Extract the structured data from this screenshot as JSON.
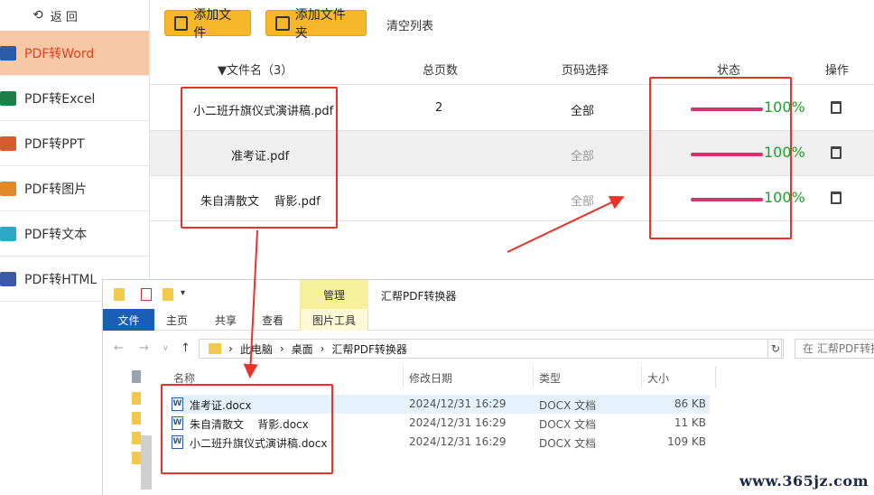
{
  "sidebar": {
    "back_label": "返 回",
    "items": [
      {
        "label": "PDF转Word",
        "icon": "word-icon",
        "active": true
      },
      {
        "label": "PDF转Excel",
        "icon": "excel-icon"
      },
      {
        "label": "PDF转PPT",
        "icon": "ppt-icon"
      },
      {
        "label": "PDF转图片",
        "icon": "image-icon"
      },
      {
        "label": "PDF转文本",
        "icon": "text-icon"
      },
      {
        "label": "PDF转HTML",
        "icon": "html-icon"
      }
    ]
  },
  "toolbar": {
    "add_file": "添加文件",
    "add_folder": "添加文件夹",
    "clear_list": "清空列表"
  },
  "table": {
    "headers": {
      "filename": "▼文件名（3）",
      "pages": "总页数",
      "page_select": "页码选择",
      "status": "状态",
      "action": "操作"
    },
    "rows": [
      {
        "name": "小二班升旗仪式演讲稿.pdf",
        "pages": "2",
        "page_select": "全部",
        "progress": 100,
        "status": "100%"
      },
      {
        "name": "准考证.pdf",
        "pages": "",
        "page_select": "全部",
        "progress": 100,
        "status": "100%"
      },
      {
        "name": "朱自清散文    背影.pdf",
        "pages": "",
        "page_select": "全部",
        "progress": 100,
        "status": "100%"
      }
    ]
  },
  "explorer": {
    "manage_tab": "管理",
    "window_title": "汇帮PDF转换器",
    "ribbon_tabs": [
      "文件",
      "主页",
      "共享",
      "查看",
      "图片工具"
    ],
    "path": [
      "此电脑",
      "桌面",
      "汇帮PDF转换器"
    ],
    "search_placeholder": "在 汇帮PDF转换",
    "columns": {
      "name": "名称",
      "modified": "修改日期",
      "type": "类型",
      "size": "大小"
    },
    "files": [
      {
        "name": "准考证.docx",
        "modified": "2024/12/31 16:29",
        "type": "DOCX 文档",
        "size": "86 KB"
      },
      {
        "name": "朱自清散文    背影.docx",
        "modified": "2024/12/31 16:29",
        "type": "DOCX 文档",
        "size": "11 KB"
      },
      {
        "name": "小二班升旗仪式演讲稿.docx",
        "modified": "2024/12/31 16:29",
        "type": "DOCX 文档",
        "size": "109 KB"
      }
    ]
  },
  "watermark": "www.365jz.com",
  "colors": {
    "accent_orange": "#f8b72a",
    "active_nav_bg": "#f7c7a6",
    "progress_bar": "#d6336c",
    "status_green": "#1e9e2d",
    "highlight_red": "#e8322a"
  }
}
